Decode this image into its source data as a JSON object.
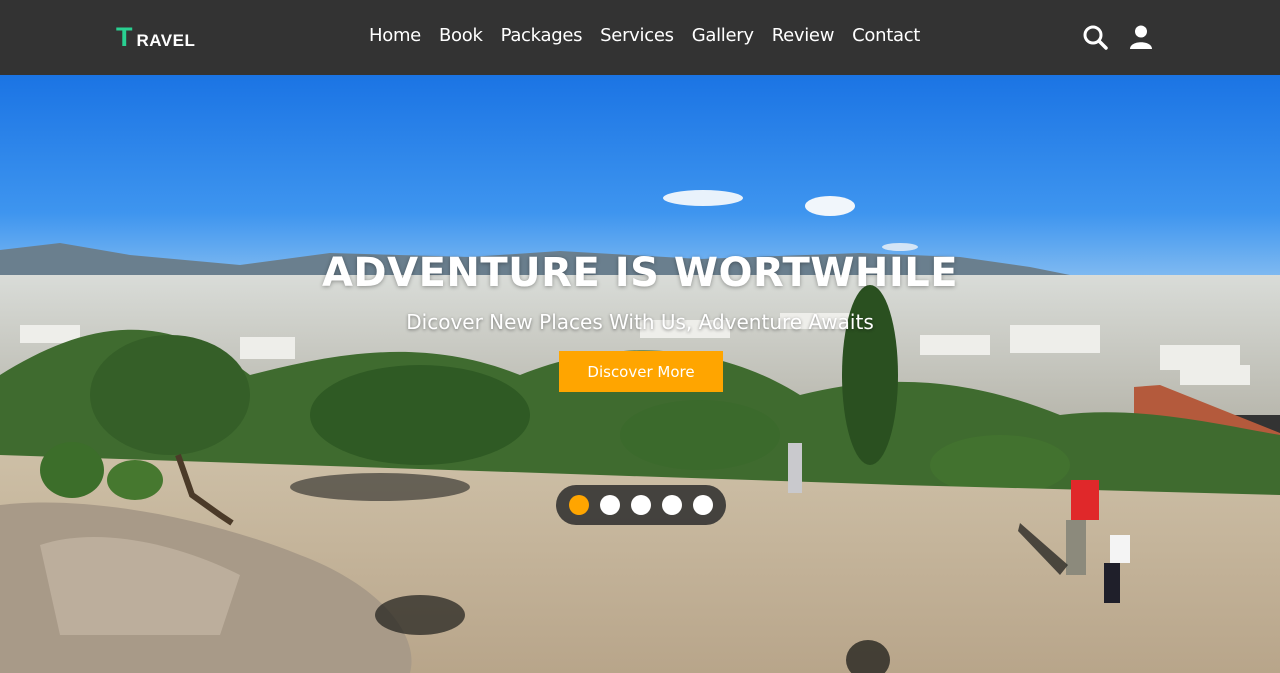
{
  "brand": {
    "accent_letter": "T",
    "rest": "RAVEL"
  },
  "nav": {
    "links": [
      "Home",
      "Book",
      "Packages",
      "Services",
      "Gallery",
      "Review",
      "Contact"
    ]
  },
  "icons": {
    "search": "search-icon",
    "user": "user-icon"
  },
  "hero": {
    "title": "ADVENTURE IS WORTWHILE",
    "subtitle": "Dicover New Places With Us, Adventure Awaits",
    "cta_label": "Discover More",
    "slides_total": 5,
    "active_slide": 1
  },
  "colors": {
    "navbar": "#333333",
    "accent_green": "#29d091",
    "cta_orange": "#ffa500",
    "sky": "#2a84e8"
  }
}
